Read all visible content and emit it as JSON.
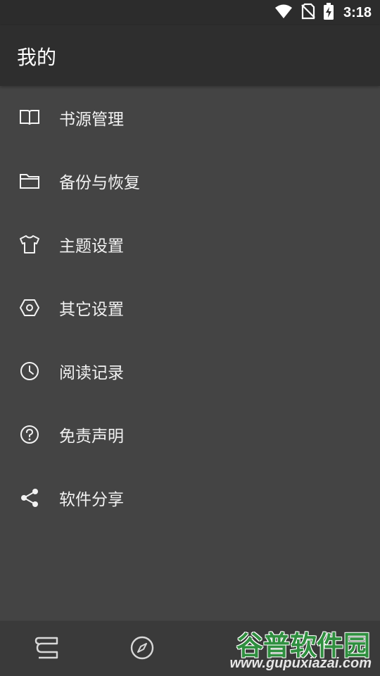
{
  "status_bar": {
    "time": "3:18",
    "icons": [
      "wifi-icon",
      "no-sim-icon",
      "battery-charging-icon"
    ]
  },
  "app_bar": {
    "title": "我的"
  },
  "menu": {
    "items": [
      {
        "label": "书源管理",
        "icon": "book-open-icon"
      },
      {
        "label": "备份与恢复",
        "icon": "folder-icon"
      },
      {
        "label": "主题设置",
        "icon": "shirt-icon"
      },
      {
        "label": "其它设置",
        "icon": "hexagon-settings-icon"
      },
      {
        "label": "阅读记录",
        "icon": "clock-icon"
      },
      {
        "label": "免责声明",
        "icon": "help-circle-icon"
      },
      {
        "label": "软件分享",
        "icon": "share-icon"
      }
    ]
  },
  "bottom_nav": {
    "icons": [
      "bookshelf-icon",
      "compass-icon"
    ]
  },
  "watermark": {
    "title": "谷普软件园",
    "url": "www.gupuxiazai.com"
  },
  "colors": {
    "background": "#444444",
    "app_bar": "#2e2e2e",
    "status_bar": "#2c2c2c",
    "watermark_green": "#2f8f3f"
  }
}
